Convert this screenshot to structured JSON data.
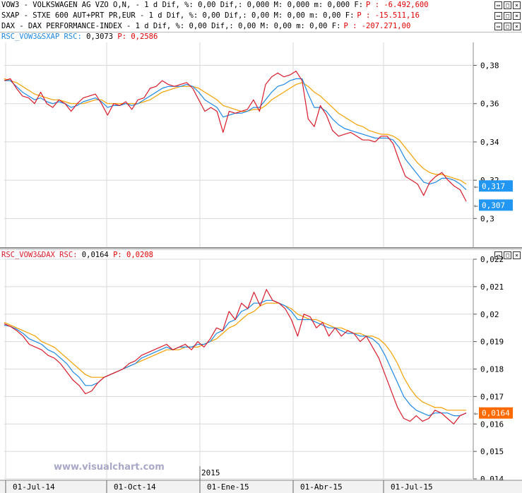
{
  "headers": [
    {
      "text": "VOW3 - VOLKSWAGEN AG VZO O,N, -  1 d Dif, %: 0,00 Dif,: 0,000 M: 0,000 m: 0,000 F:",
      "p": "P : -6.492,600"
    },
    {
      "text": "SXAP - STXE 600 AUT+PRT PR,EUR -  1 d Dif, %: 0,00 Dif,: 0,00 M: 0,00 m: 0,00 F:",
      "p": "P : -15.511,16"
    },
    {
      "text": "DAX - DAX PERFORMANCE-INDEX -  1 d Dif, %: 0,00 Dif,: 0,00 M: 0,00 m: 0,00 F:",
      "p": "P : -207.271,00"
    }
  ],
  "window_buttons": [
    "restore",
    "maximize",
    "close"
  ],
  "panel1": {
    "title": "RSC_VOW3&SXAP RSC:",
    "value": "0,3073",
    "p": "P: 0,2586"
  },
  "panel2": {
    "title": "RSC_VOW3&DAX RSC:",
    "value": "0,0164",
    "p": "P: 0,0208"
  },
  "watermark": "www.visualchart.com",
  "year_marker": "2015",
  "colors": {
    "price": "#d81b2a",
    "fast_ma": "#1e88e5",
    "slow_ma": "#f5a000",
    "badge_blue": "#2196f3",
    "badge_orange": "#ff6a00"
  },
  "chart_data": [
    {
      "type": "line",
      "title": "RSC_VOW3&SXAP RSC",
      "x": [
        "01-Jul-14",
        "01-Oct-14",
        "01-Ene-15",
        "01-Abr-15",
        "01-Jul-15"
      ],
      "ylim": [
        0.285,
        0.392
      ],
      "yticks": [
        "0,3",
        "0,32",
        "0,34",
        "0,36",
        "0,38"
      ],
      "grid": true,
      "badges": [
        {
          "label": "0,317",
          "value": 0.317,
          "color": "blue"
        },
        {
          "label": "0,307",
          "value": 0.307,
          "color": "blue"
        }
      ],
      "series": [
        {
          "values": [
            0.372,
            0.373,
            0.368,
            0.364,
            0.363,
            0.36,
            0.366,
            0.36,
            0.358,
            0.362,
            0.36,
            0.356,
            0.36,
            0.363,
            0.364,
            0.365,
            0.36,
            0.354,
            0.36,
            0.359,
            0.361,
            0.357,
            0.362,
            0.363,
            0.368,
            0.369,
            0.372,
            0.37,
            0.369,
            0.37,
            0.371,
            0.368,
            0.362,
            0.356,
            0.358,
            0.356,
            0.345,
            0.356,
            0.355,
            0.356,
            0.357,
            0.362,
            0.356,
            0.37,
            0.374,
            0.376,
            0.374,
            0.375,
            0.377,
            0.372,
            0.352,
            0.348,
            0.359,
            0.354,
            0.346,
            0.343,
            0.344,
            0.345,
            0.343,
            0.341,
            0.341,
            0.34,
            0.343,
            0.343,
            0.339,
            0.33,
            0.322,
            0.32,
            0.318,
            0.312,
            0.319,
            0.322,
            0.324,
            0.32,
            0.317,
            0.315,
            0.309
          ]
        },
        {
          "values": [
            0.372,
            0.372,
            0.369,
            0.366,
            0.364,
            0.362,
            0.363,
            0.361,
            0.36,
            0.361,
            0.36,
            0.358,
            0.359,
            0.361,
            0.362,
            0.363,
            0.361,
            0.358,
            0.359,
            0.359,
            0.36,
            0.359,
            0.36,
            0.362,
            0.364,
            0.366,
            0.368,
            0.369,
            0.369,
            0.369,
            0.37,
            0.369,
            0.366,
            0.362,
            0.36,
            0.358,
            0.353,
            0.354,
            0.355,
            0.355,
            0.356,
            0.358,
            0.358,
            0.362,
            0.366,
            0.369,
            0.37,
            0.372,
            0.373,
            0.373,
            0.365,
            0.358,
            0.358,
            0.356,
            0.352,
            0.349,
            0.347,
            0.346,
            0.345,
            0.344,
            0.343,
            0.342,
            0.342,
            0.342,
            0.341,
            0.337,
            0.331,
            0.327,
            0.323,
            0.319,
            0.318,
            0.319,
            0.321,
            0.321,
            0.32,
            0.318,
            0.315
          ]
        },
        {
          "values": [
            0.373,
            0.372,
            0.371,
            0.369,
            0.367,
            0.365,
            0.364,
            0.363,
            0.362,
            0.362,
            0.361,
            0.36,
            0.36,
            0.36,
            0.361,
            0.362,
            0.362,
            0.36,
            0.36,
            0.36,
            0.36,
            0.36,
            0.36,
            0.361,
            0.362,
            0.364,
            0.366,
            0.367,
            0.368,
            0.369,
            0.369,
            0.369,
            0.368,
            0.366,
            0.364,
            0.362,
            0.359,
            0.358,
            0.357,
            0.356,
            0.356,
            0.357,
            0.357,
            0.359,
            0.362,
            0.364,
            0.366,
            0.368,
            0.37,
            0.371,
            0.369,
            0.366,
            0.364,
            0.361,
            0.358,
            0.355,
            0.353,
            0.351,
            0.349,
            0.348,
            0.346,
            0.345,
            0.344,
            0.344,
            0.343,
            0.341,
            0.337,
            0.333,
            0.329,
            0.326,
            0.324,
            0.323,
            0.323,
            0.322,
            0.321,
            0.32,
            0.318
          ]
        }
      ]
    },
    {
      "type": "line",
      "title": "RSC_VOW3&DAX RSC",
      "x": [
        "01-Jul-14",
        "01-Oct-14",
        "01-Ene-15",
        "01-Abr-15",
        "01-Jul-15"
      ],
      "ylim": [
        0.014,
        0.022
      ],
      "yticks": [
        "0,014",
        "0,015",
        "0,016",
        "0,017",
        "0,018",
        "0,019",
        "0,02",
        "0,021",
        "0,022"
      ],
      "grid": true,
      "badges": [
        {
          "label": "0,0164",
          "value": 0.0164,
          "color": "orange"
        }
      ],
      "series": [
        {
          "values": [
            0.01965,
            0.01955,
            0.0194,
            0.0192,
            0.0189,
            0.0188,
            0.0187,
            0.0185,
            0.0184,
            0.0182,
            0.0179,
            0.0176,
            0.0174,
            0.0171,
            0.0172,
            0.0175,
            0.0177,
            0.0178,
            0.0179,
            0.018,
            0.0182,
            0.0183,
            0.0185,
            0.0186,
            0.0187,
            0.0188,
            0.0189,
            0.0187,
            0.0188,
            0.0189,
            0.0187,
            0.019,
            0.0188,
            0.0191,
            0.0195,
            0.0194,
            0.0201,
            0.0198,
            0.0204,
            0.0202,
            0.0208,
            0.0203,
            0.0209,
            0.0205,
            0.0204,
            0.0202,
            0.0198,
            0.0192,
            0.02,
            0.0199,
            0.0195,
            0.0197,
            0.0192,
            0.0195,
            0.0192,
            0.0194,
            0.0193,
            0.019,
            0.0192,
            0.0188,
            0.0184,
            0.0178,
            0.0172,
            0.0166,
            0.0162,
            0.0161,
            0.0163,
            0.0161,
            0.0162,
            0.0165,
            0.0164,
            0.0162,
            0.016,
            0.0163,
            0.0164
          ]
        },
        {
          "values": [
            0.0196,
            0.01955,
            0.01945,
            0.0193,
            0.0191,
            0.019,
            0.0189,
            0.0187,
            0.0186,
            0.0184,
            0.0182,
            0.0179,
            0.0177,
            0.0174,
            0.0174,
            0.0175,
            0.0177,
            0.0178,
            0.0179,
            0.018,
            0.0181,
            0.0182,
            0.0184,
            0.0185,
            0.0186,
            0.0187,
            0.0188,
            0.0187,
            0.0188,
            0.0188,
            0.0188,
            0.0189,
            0.0189,
            0.019,
            0.0193,
            0.0194,
            0.0197,
            0.0198,
            0.0201,
            0.0202,
            0.0204,
            0.0204,
            0.0205,
            0.0205,
            0.0204,
            0.0203,
            0.0201,
            0.0198,
            0.0198,
            0.0198,
            0.0197,
            0.0196,
            0.0195,
            0.0195,
            0.0194,
            0.0193,
            0.0193,
            0.0192,
            0.0192,
            0.0191,
            0.0189,
            0.0185,
            0.018,
            0.0175,
            0.017,
            0.0167,
            0.0165,
            0.0164,
            0.0163,
            0.0164,
            0.0164,
            0.0164,
            0.0163,
            0.0163,
            0.0164
          ]
        },
        {
          "values": [
            0.0197,
            0.0196,
            0.0195,
            0.0194,
            0.0193,
            0.0192,
            0.019,
            0.0189,
            0.0188,
            0.0186,
            0.0184,
            0.0182,
            0.018,
            0.0178,
            0.0177,
            0.0177,
            0.0177,
            0.0178,
            0.0179,
            0.018,
            0.0181,
            0.0182,
            0.0183,
            0.0184,
            0.0185,
            0.0186,
            0.0187,
            0.0187,
            0.0187,
            0.0188,
            0.0188,
            0.0188,
            0.0189,
            0.019,
            0.0191,
            0.0193,
            0.0195,
            0.0196,
            0.0198,
            0.02,
            0.0201,
            0.0203,
            0.0204,
            0.0204,
            0.0204,
            0.0203,
            0.0202,
            0.02,
            0.0199,
            0.0198,
            0.0198,
            0.0197,
            0.0196,
            0.0195,
            0.0195,
            0.0194,
            0.0193,
            0.0193,
            0.0192,
            0.0192,
            0.0191,
            0.0189,
            0.0186,
            0.0182,
            0.0177,
            0.0173,
            0.017,
            0.0168,
            0.0167,
            0.0166,
            0.0166,
            0.0165,
            0.0165,
            0.0165,
            0.0165
          ]
        }
      ]
    }
  ]
}
